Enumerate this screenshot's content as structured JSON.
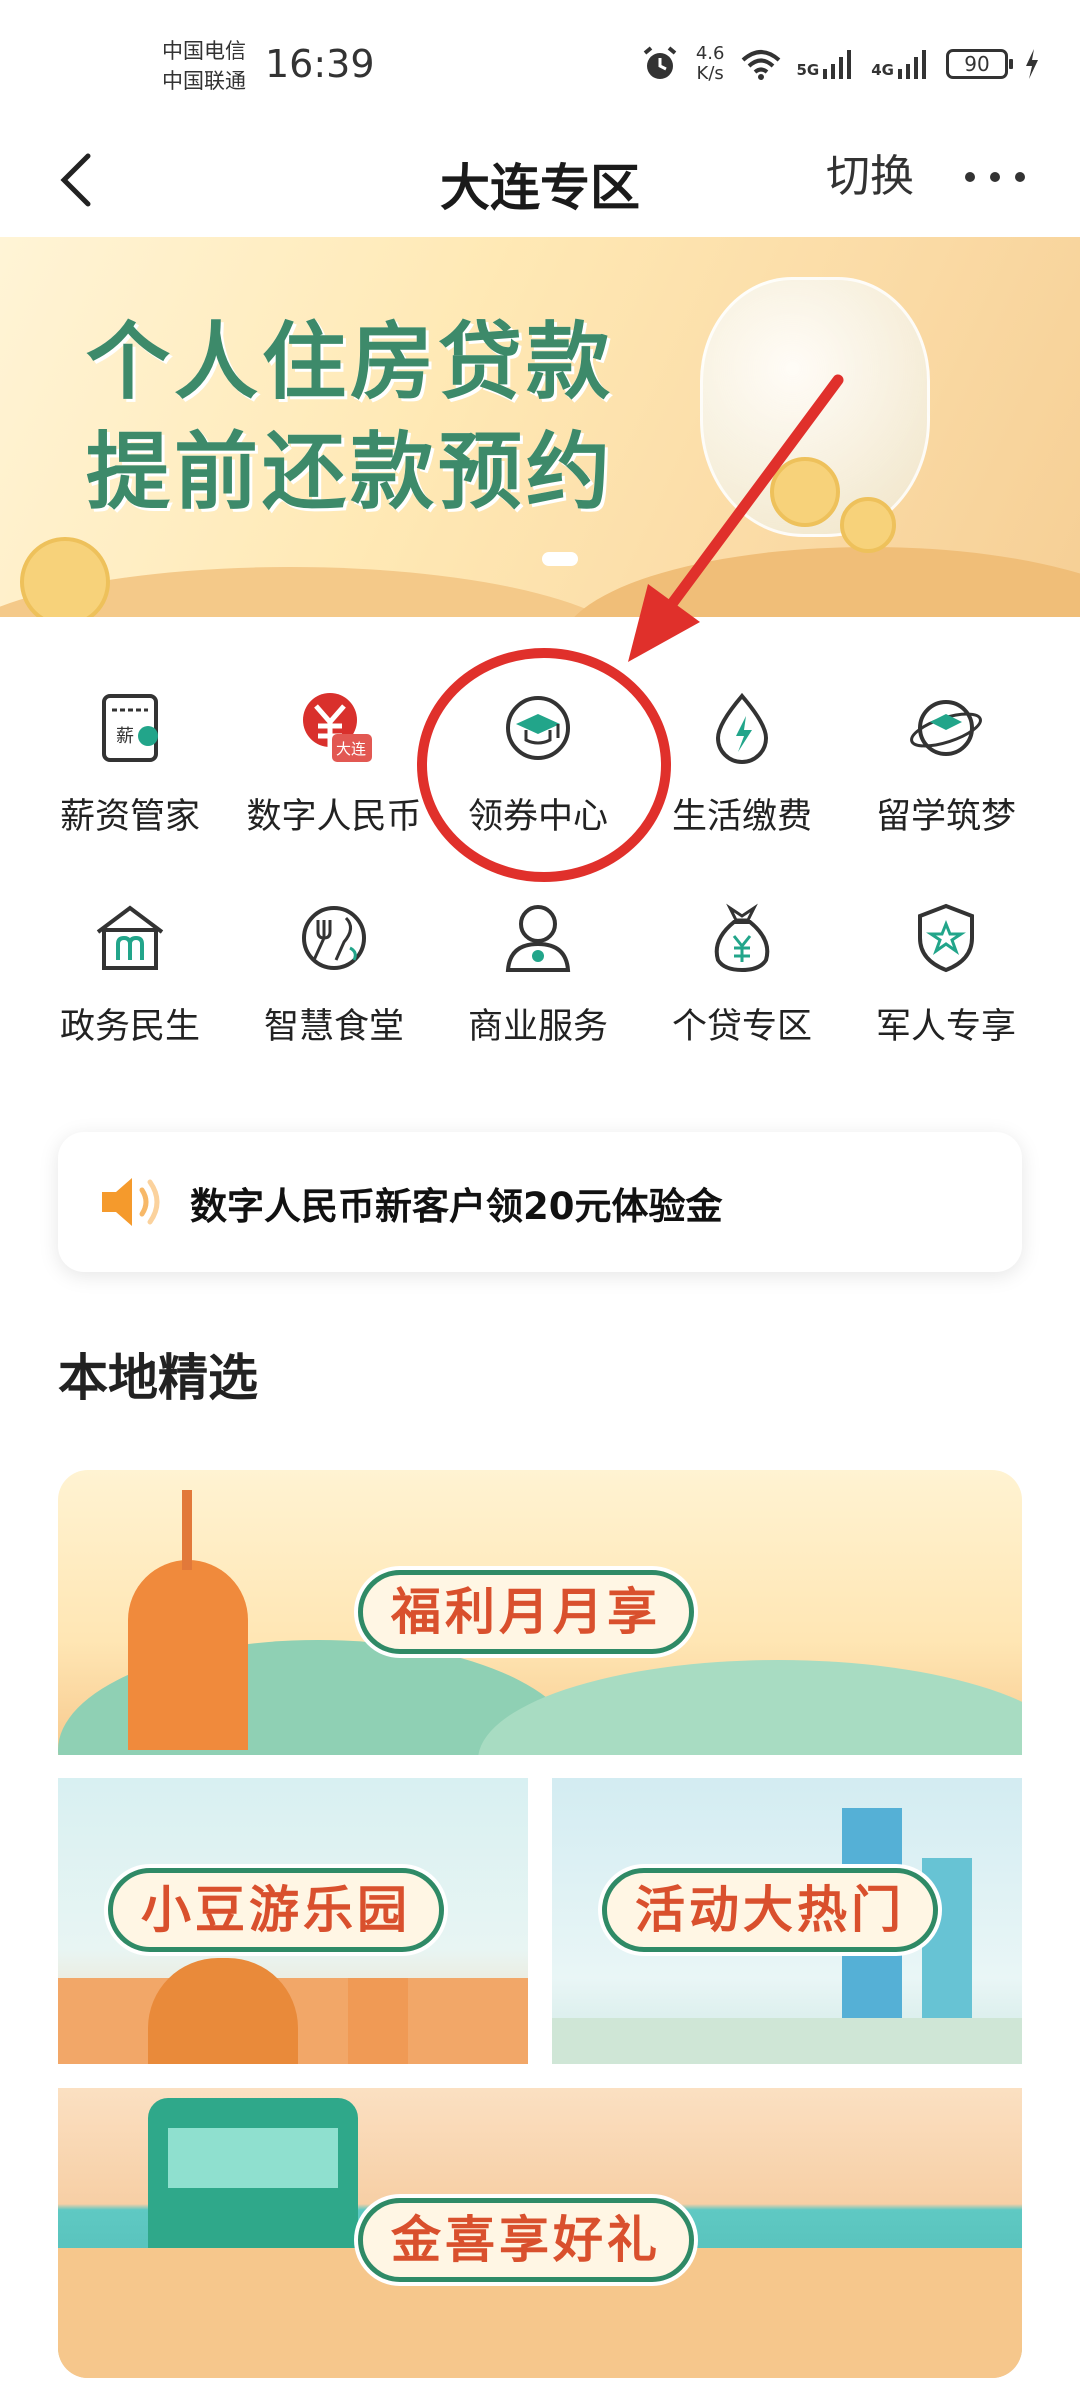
{
  "status_bar": {
    "carrier1": "中国电信",
    "carrier2": "中国联通",
    "time": "16:39",
    "speed_value": "4.6",
    "speed_unit": "K/s",
    "net1": "5G",
    "net2": "4G",
    "battery": "90"
  },
  "nav": {
    "title": "大连专区",
    "switch_label": "切换"
  },
  "banner": {
    "line1": "个人住房贷款",
    "line2": "提前还款预约"
  },
  "grid": {
    "items": [
      {
        "label": "薪资管家",
        "icon": "salary-icon",
        "badge": "薪"
      },
      {
        "label": "数字人民币",
        "icon": "digital-rmb-icon",
        "badge": "大连"
      },
      {
        "label": "领券中心",
        "icon": "coupon-center-icon"
      },
      {
        "label": "生活缴费",
        "icon": "utility-payment-icon"
      },
      {
        "label": "留学筑梦",
        "icon": "study-abroad-icon"
      },
      {
        "label": "政务民生",
        "icon": "government-service-icon"
      },
      {
        "label": "智慧食堂",
        "icon": "smart-canteen-icon"
      },
      {
        "label": "商业服务",
        "icon": "business-service-icon"
      },
      {
        "label": "个贷专区",
        "icon": "personal-loan-icon"
      },
      {
        "label": "军人专享",
        "icon": "military-exclusive-icon"
      }
    ]
  },
  "notice": {
    "text": "数字人民币新客户领20元体验金",
    "icon": "speaker-icon"
  },
  "section": {
    "title": "本地精选"
  },
  "promos": [
    {
      "label": "福利月月享"
    },
    {
      "label": "小豆游乐园"
    },
    {
      "label": "活动大热门"
    },
    {
      "label": "金喜享好礼"
    }
  ],
  "colors": {
    "brand_green": "#2f8a66",
    "icon_green": "#22a58a",
    "icon_dark": "#333333",
    "annotation_red": "#e0302b",
    "promo_text": "#d9502d"
  }
}
